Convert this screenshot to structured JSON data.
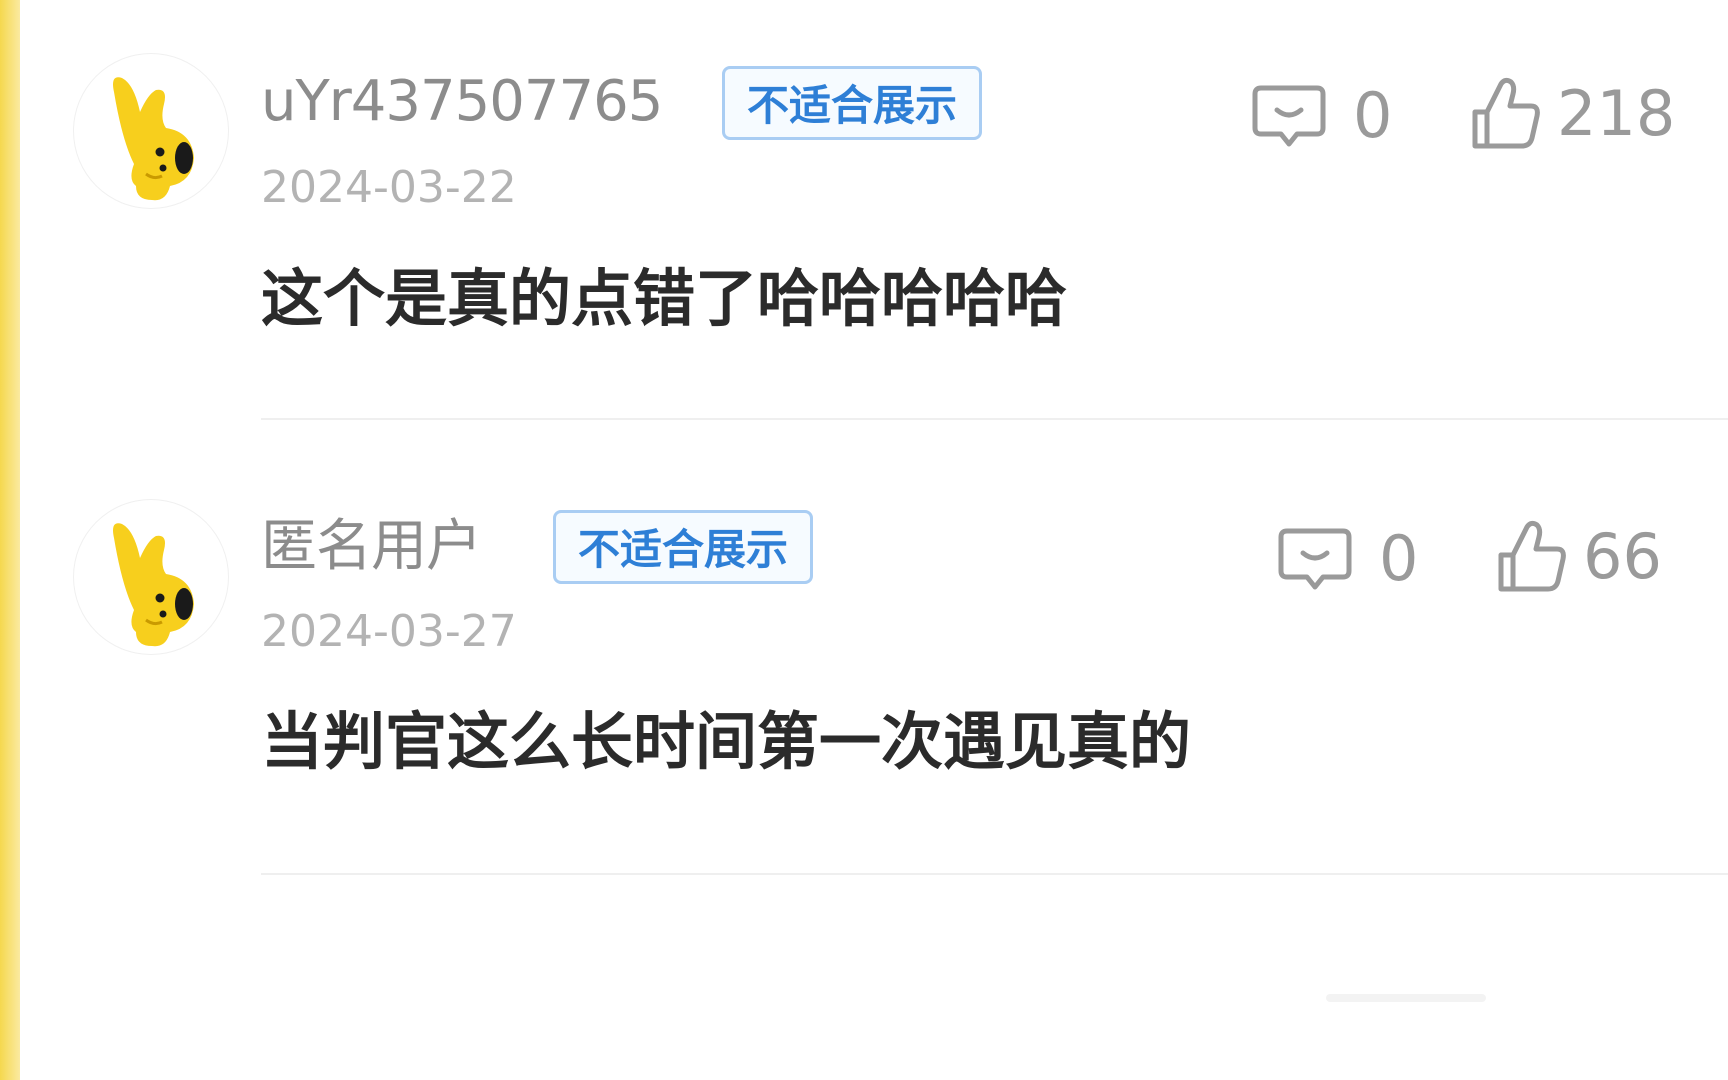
{
  "comments": [
    {
      "username": "uYr437507765",
      "badge": "不适合展示",
      "date": "2024-03-22",
      "text": "这个是真的点错了哈哈哈哈哈",
      "reply_count": "0",
      "like_count": "218",
      "avatar_icon": "yellow-rabbit-mascot-icon"
    },
    {
      "username": "匿名用户",
      "badge": "不适合展示",
      "date": "2024-03-27",
      "text": "当判官这么长时间第一次遇见真的",
      "reply_count": "0",
      "like_count": "66",
      "avatar_icon": "yellow-rabbit-mascot-icon"
    }
  ],
  "icons": {
    "reply": "comment-bubble-icon",
    "like": "thumbs-up-icon"
  },
  "colors": {
    "frame_yellow": "#f5d84e",
    "badge_blue": "#2e7fd6",
    "badge_border": "#a9cdf3",
    "mascot_yellow": "#f7cf1d"
  }
}
